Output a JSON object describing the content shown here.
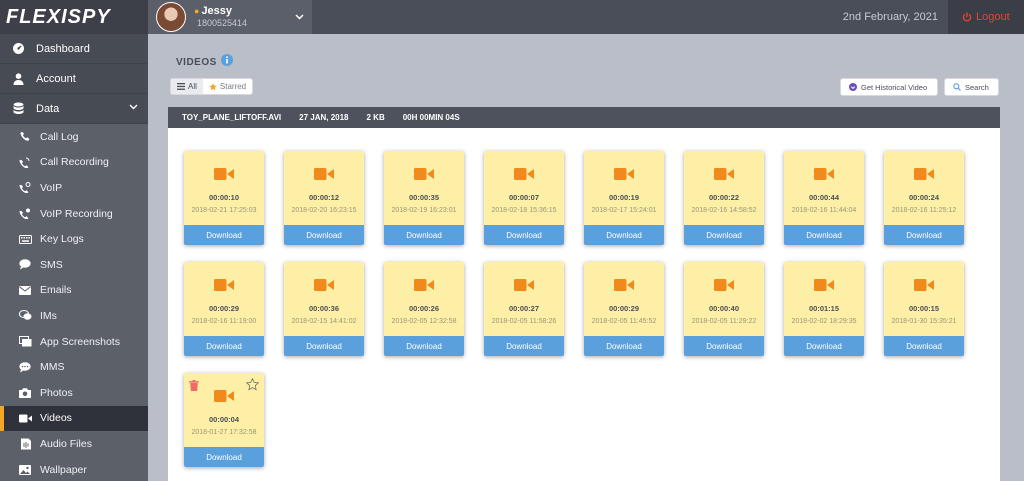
{
  "app": {
    "logo_text": "FLEXISPY"
  },
  "user": {
    "name": "Jessy",
    "phone": "1800525414"
  },
  "header": {
    "date": "2nd February, 2021",
    "logout_label": "Logout"
  },
  "sidebar": {
    "top": [
      {
        "label": "Dashboard",
        "icon": "dashboard-icon"
      },
      {
        "label": "Account",
        "icon": "user-icon"
      },
      {
        "label": "Data",
        "icon": "database-icon"
      }
    ],
    "items": [
      {
        "label": "Call Log",
        "icon": "phone-icon"
      },
      {
        "label": "Call Recording",
        "icon": "phone-record-icon"
      },
      {
        "label": "VoIP",
        "icon": "voip-icon"
      },
      {
        "label": "VoIP Recording",
        "icon": "voip-record-icon"
      },
      {
        "label": "Key Logs",
        "icon": "keyboard-icon"
      },
      {
        "label": "SMS",
        "icon": "chat-icon"
      },
      {
        "label": "Emails",
        "icon": "envelope-icon"
      },
      {
        "label": "IMs",
        "icon": "im-icon"
      },
      {
        "label": "App Screenshots",
        "icon": "screenshots-icon"
      },
      {
        "label": "MMS",
        "icon": "mms-icon"
      },
      {
        "label": "Photos",
        "icon": "camera-icon"
      },
      {
        "label": "Videos",
        "icon": "video-icon",
        "active": true
      },
      {
        "label": "Audio Files",
        "icon": "audio-icon"
      },
      {
        "label": "Wallpaper",
        "icon": "image-icon"
      }
    ]
  },
  "page": {
    "title": "VIDEOS",
    "filter_all": "All",
    "filter_starred": "Starred",
    "historical_button": "Get Historical Video",
    "search_button": "Search"
  },
  "selected_file": {
    "name": "TOY_PLANE_LIFTOFF.AVI",
    "date": "27 JAN, 2018",
    "size": "2 KB",
    "duration": "00H 00MIN 04S"
  },
  "download_label": "Download",
  "videos": [
    {
      "duration": "00:00:10",
      "timestamp": "2018-02-21 17:25:03"
    },
    {
      "duration": "00:00:12",
      "timestamp": "2018-02-20 16:23:15"
    },
    {
      "duration": "00:00:35",
      "timestamp": "2018-02-19 16:23:01"
    },
    {
      "duration": "00:00:07",
      "timestamp": "2018-02-18 15:36:15"
    },
    {
      "duration": "00:00:19",
      "timestamp": "2018-02-17 15:24:01"
    },
    {
      "duration": "00:00:22",
      "timestamp": "2018-02-16 14:58:52"
    },
    {
      "duration": "00:00:44",
      "timestamp": "2018-02-16 11:44:04"
    },
    {
      "duration": "00:00:24",
      "timestamp": "2018-02-16 11:25:12"
    },
    {
      "duration": "00:00:29",
      "timestamp": "2018-02-16 11:19:00"
    },
    {
      "duration": "00:00:36",
      "timestamp": "2018-02-15 14:41:02"
    },
    {
      "duration": "00:00:26",
      "timestamp": "2018-02-05 12:32:58"
    },
    {
      "duration": "00:00:27",
      "timestamp": "2018-02-05 11:58:26"
    },
    {
      "duration": "00:00:29",
      "timestamp": "2018-02-05 11:45:52"
    },
    {
      "duration": "00:00:40",
      "timestamp": "2018-02-05 11:29:22"
    },
    {
      "duration": "00:01:15",
      "timestamp": "2018-02-02 18:29:35"
    },
    {
      "duration": "00:00:15",
      "timestamp": "2018-01-30 15:35:21"
    },
    {
      "duration": "00:00:04",
      "timestamp": "2018-01-27 17:32:58",
      "selected": true
    }
  ],
  "colors": {
    "accent": "#f5a623",
    "download": "#5aa0dc",
    "card": "#fdf0a6",
    "logout": "#e5452b"
  }
}
